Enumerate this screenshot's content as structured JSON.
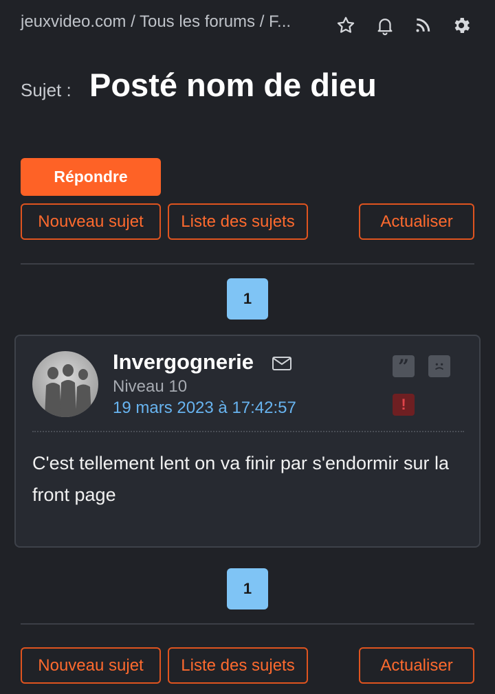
{
  "breadcrumb": "jeuxvideo.com / Tous les forums / F...",
  "topic": {
    "label": "Sujet :",
    "title": "Posté nom de dieu"
  },
  "buttons": {
    "reply": "Répondre",
    "new_topic": "Nouveau sujet",
    "topic_list": "Liste des sujets",
    "refresh": "Actualiser"
  },
  "pagination": {
    "current_page": "1"
  },
  "post": {
    "author": "Invergognerie",
    "level": "Niveau 10",
    "date": "19 mars 2023 à 17:42:57",
    "body": "C'est tellement lent on va finir par s'endormir sur la front page"
  },
  "icons": {
    "top": [
      "star-icon",
      "bell-icon",
      "rss-icon",
      "gear-icon"
    ],
    "post": [
      "mail-icon",
      "quote-icon",
      "sad-face-icon",
      "alert-icon"
    ]
  },
  "colors": {
    "background": "#202227",
    "accent": "#fe6226",
    "link": "#68b4f0",
    "page_button": "#7fc4f5",
    "alert": "#7a1f1f"
  }
}
